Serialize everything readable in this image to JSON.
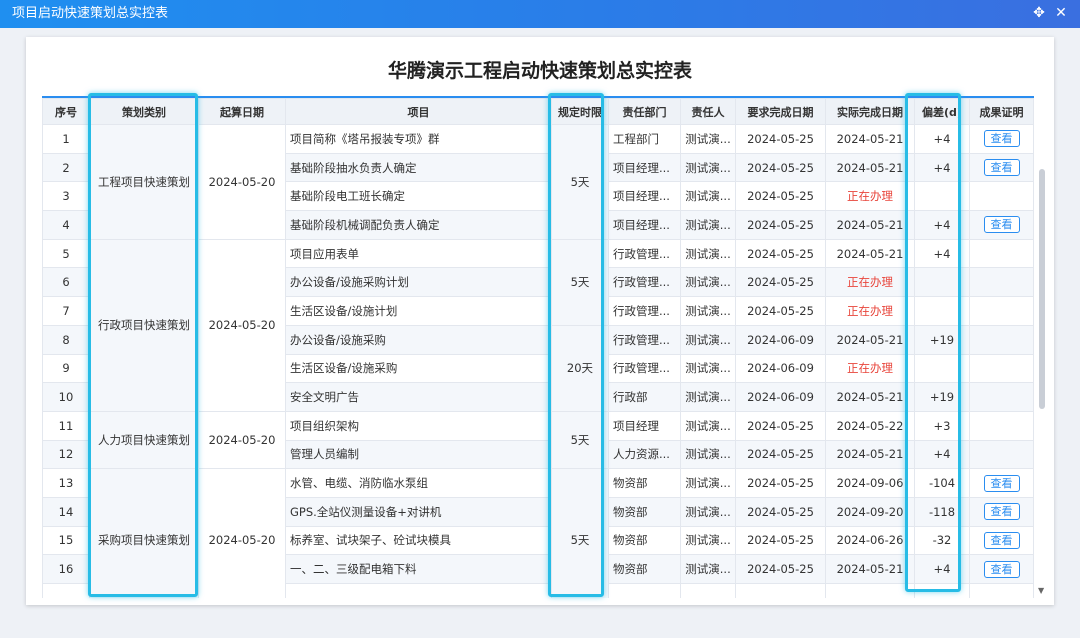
{
  "window": {
    "title": "项目启动快速策划总实控表",
    "move_icon": "✥",
    "close_icon": "✕"
  },
  "sheet": {
    "title": "华腾演示工程启动快速策划总实控表"
  },
  "headers": [
    "序号",
    "策划类别",
    "起算日期",
    "项目",
    "规定时限",
    "责任部门",
    "责任人",
    "要求完成日期",
    "实际完成日期",
    "偏差(d)",
    "成果证明"
  ],
  "groups": [
    {
      "category": "工程项目快速策划",
      "start": "2024-05-20",
      "rows": 4,
      "rule_span": 4,
      "rule": "5天"
    },
    {
      "category": "行政项目快速策划",
      "start": "2024-05-20",
      "rows": 6
    },
    {
      "category": "人力项目快速策划",
      "start": "2024-05-20",
      "rows": 2
    },
    {
      "category": "采购项目快速策划",
      "start": "2024-05-20",
      "rows": 5
    }
  ],
  "rule_blocks": [
    {
      "label": "5天",
      "rows": 4
    },
    {
      "label": "5天",
      "rows": 3
    },
    {
      "label": "20天",
      "rows": 3
    },
    {
      "label": "5天",
      "rows": 2
    },
    {
      "label": "5天",
      "rows": 5
    }
  ],
  "rows": [
    {
      "no": "1",
      "item": "项目简称《塔吊报装专项》群",
      "dept": "工程部门",
      "owner": "测试演...",
      "due": "2024-05-25",
      "done": "2024-05-21",
      "dev": "+4",
      "proof": "查看"
    },
    {
      "no": "2",
      "item": "基础阶段抽水负责人确定",
      "dept": "项目经理...",
      "owner": "测试演...",
      "due": "2024-05-25",
      "done": "2024-05-21",
      "dev": "+4",
      "proof": "查看"
    },
    {
      "no": "3",
      "item": "基础阶段电工班长确定",
      "dept": "项目经理...",
      "owner": "测试演...",
      "due": "2024-05-25",
      "done": "正在办理",
      "dev": "",
      "proof": ""
    },
    {
      "no": "4",
      "item": "基础阶段机械调配负责人确定",
      "dept": "项目经理...",
      "owner": "测试演...",
      "due": "2024-05-25",
      "done": "2024-05-21",
      "dev": "+4",
      "proof": "查看"
    },
    {
      "no": "5",
      "item": "项目应用表单",
      "dept": "行政管理...",
      "owner": "测试演...",
      "due": "2024-05-25",
      "done": "2024-05-21",
      "dev": "+4",
      "proof": ""
    },
    {
      "no": "6",
      "item": "办公设备/设施采购计划",
      "dept": "行政管理...",
      "owner": "测试演...",
      "due": "2024-05-25",
      "done": "正在办理",
      "dev": "",
      "proof": ""
    },
    {
      "no": "7",
      "item": "生活区设备/设施计划",
      "dept": "行政管理...",
      "owner": "测试演...",
      "due": "2024-05-25",
      "done": "正在办理",
      "dev": "",
      "proof": ""
    },
    {
      "no": "8",
      "item": "办公设备/设施采购",
      "dept": "行政管理...",
      "owner": "测试演...",
      "due": "2024-06-09",
      "done": "2024-05-21",
      "dev": "+19",
      "proof": ""
    },
    {
      "no": "9",
      "item": "生活区设备/设施采购",
      "dept": "行政管理...",
      "owner": "测试演...",
      "due": "2024-06-09",
      "done": "正在办理",
      "dev": "",
      "proof": ""
    },
    {
      "no": "10",
      "item": "安全文明广告",
      "dept": "行政部",
      "owner": "测试演...",
      "due": "2024-06-09",
      "done": "2024-05-21",
      "dev": "+19",
      "proof": ""
    },
    {
      "no": "11",
      "item": "项目组织架构",
      "dept": "项目经理",
      "owner": "测试演...",
      "due": "2024-05-25",
      "done": "2024-05-22",
      "dev": "+3",
      "proof": ""
    },
    {
      "no": "12",
      "item": "管理人员编制",
      "dept": "人力资源...",
      "owner": "测试演...",
      "due": "2024-05-25",
      "done": "2024-05-21",
      "dev": "+4",
      "proof": ""
    },
    {
      "no": "13",
      "item": "水管、电缆、消防临水泵组",
      "dept": "物资部",
      "owner": "测试演...",
      "due": "2024-05-25",
      "done": "2024-09-06",
      "dev": "-104",
      "proof": "查看"
    },
    {
      "no": "14",
      "item": "GPS.全站仪测量设备+对讲机",
      "dept": "物资部",
      "owner": "测试演...",
      "due": "2024-05-25",
      "done": "2024-09-20",
      "dev": "-118",
      "proof": "查看"
    },
    {
      "no": "15",
      "item": "标养室、试块架子、砼试块模具",
      "dept": "物资部",
      "owner": "测试演...",
      "due": "2024-05-25",
      "done": "2024-06-26",
      "dev": "-32",
      "proof": "查看"
    },
    {
      "no": "16",
      "item": "一、二、三级配电箱下料",
      "dept": "物资部",
      "owner": "测试演...",
      "due": "2024-05-25",
      "done": "2024-05-21",
      "dev": "+4",
      "proof": "查看"
    },
    {
      "no": "",
      "item": "",
      "dept": "",
      "owner": "",
      "due": "",
      "done": "",
      "dev": "",
      "proof": ""
    }
  ],
  "status_colors": {
    "running": "#e8463c",
    "accent": "#2a8df0",
    "highlight": "#27bce6"
  }
}
